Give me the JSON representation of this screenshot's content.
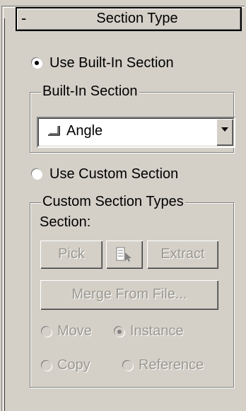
{
  "rollout": {
    "collapse_symbol": "-",
    "title": "Section Type"
  },
  "section_source": {
    "built_in_label": "Use Built-In Section",
    "built_in_selected": true,
    "custom_label": "Use Custom Section",
    "custom_selected": false
  },
  "built_in_group": {
    "title": "Built-In Section",
    "dropdown_value": "Angle",
    "dropdown_icon": "angle-shape-icon"
  },
  "custom_group": {
    "title": "Custom Section Types",
    "section_label": "Section:",
    "pick_label": "Pick",
    "extract_label": "Extract",
    "merge_label": "Merge From File...",
    "move_label": "Move",
    "move_selected": false,
    "instance_label": "Instance",
    "instance_selected": true,
    "copy_label": "Copy",
    "copy_selected": false,
    "reference_label": "Reference",
    "reference_selected": false
  },
  "colors": {
    "panel_bg": "#d4d0c8",
    "disabled_text": "#9a9890"
  }
}
